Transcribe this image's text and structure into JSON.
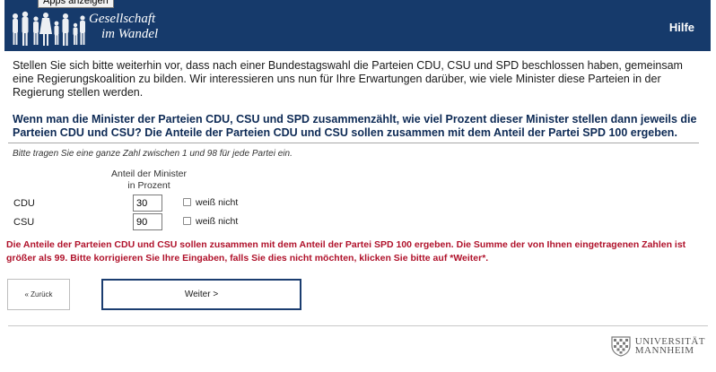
{
  "browser": {
    "tooltip": "Apps anzeigen"
  },
  "header": {
    "logo_line1": "Gesellschaft",
    "logo_line2": "im Wandel",
    "help_label": "Hilfe"
  },
  "intro": "Stellen Sie sich bitte weiterhin vor, dass nach einer Bundestagswahl die Parteien CDU, CSU und SPD beschlossen haben, gemeinsam eine Regierungskoalition zu bilden. Wir interessieren uns nun für Ihre Erwartungen darüber, wie viele Minister diese Parteien in der Regierung stellen werden.",
  "question": "Wenn man die Minister der Parteien CDU, CSU und SPD zusammenzählt, wie viel Prozent dieser Minister stellen dann jeweils die Parteien CDU und CSU? Die Anteile der Parteien CDU und CSU sollen zusammen mit dem Anteil der Partei SPD 100 ergeben.",
  "instruction": "Bitte tragen Sie eine ganze Zahl zwischen 1 und 98 für jede Partei ein.",
  "table": {
    "column_header_line1": "Anteil der Minister",
    "column_header_line2": "in Prozent",
    "rows": [
      {
        "party": "CDU",
        "value": "30",
        "dont_know_label": "weiß nicht",
        "dont_know_checked": false
      },
      {
        "party": "CSU",
        "value": "90",
        "dont_know_label": "weiß nicht",
        "dont_know_checked": false
      }
    ]
  },
  "error_message": "Die Anteile der Parteien CDU und CSU sollen zusammen mit dem Anteil der Partei SPD 100 ergeben. Die Summe der von Ihnen eingetragenen Zahlen ist größer als 99. Bitte korrigieren Sie Ihre Eingaben, falls Sie dies nicht möchten, klicken Sie bitte auf *Weiter*.",
  "nav": {
    "back_label": "« Zurück",
    "next_label": "Weiter >"
  },
  "footer": {
    "university_line1": "UNIVERSITÄT",
    "university_line2": "MANNHEIM"
  },
  "colors": {
    "header_bg": "#163a6b",
    "question_text": "#0d2a55",
    "error_text": "#b0122b",
    "next_button_border": "#1b3d70"
  }
}
